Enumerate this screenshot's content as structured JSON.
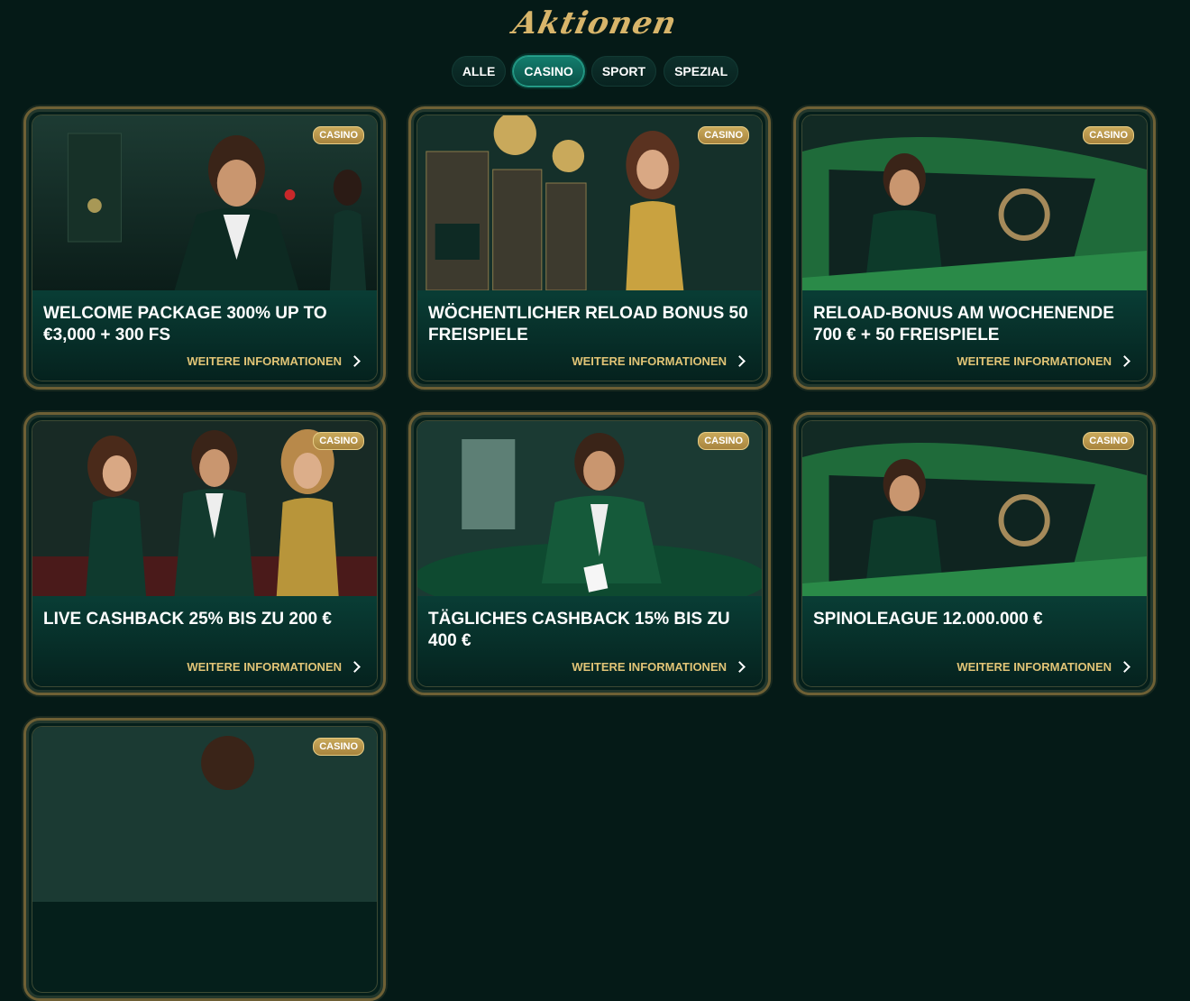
{
  "header": {
    "title": "Aktionen"
  },
  "tabs": [
    {
      "label": "ALLE"
    },
    {
      "label": "CASINO"
    },
    {
      "label": "SPORT"
    },
    {
      "label": "SPEZIAL"
    }
  ],
  "active_tab": "CASINO",
  "cards": [
    {
      "badge": "CASINO",
      "title": "WELCOME PACKAGE 300% UP TO €3,000 + 300 FS",
      "link": "WEITERE INFORMATIONEN"
    },
    {
      "badge": "CASINO",
      "title": "WÖCHENTLICHER RELOAD BONUS 50 FREISPIELE",
      "link": "WEITERE INFORMATIONEN"
    },
    {
      "badge": "CASINO",
      "title": "RELOAD-BONUS AM WOCHENENDE 700 € + 50 FREISPIELE",
      "link": "WEITERE INFORMATIONEN"
    },
    {
      "badge": "CASINO",
      "title": "LIVE CASHBACK 25% BIS ZU 200 €",
      "link": "WEITERE INFORMATIONEN"
    },
    {
      "badge": "CASINO",
      "title": "TÄGLICHES CASHBACK 15% BIS ZU 400 €",
      "link": "WEITERE INFORMATIONEN"
    },
    {
      "badge": "CASINO",
      "title": "SPINOLEAGUE 12.000.000 €",
      "link": "WEITERE INFORMATIONEN"
    },
    {
      "badge": "CASINO",
      "title": "",
      "link": ""
    }
  ],
  "colors": {
    "accent_gold": "#d8b56a",
    "background": "#051a17",
    "active_tab": "#137f6f"
  }
}
